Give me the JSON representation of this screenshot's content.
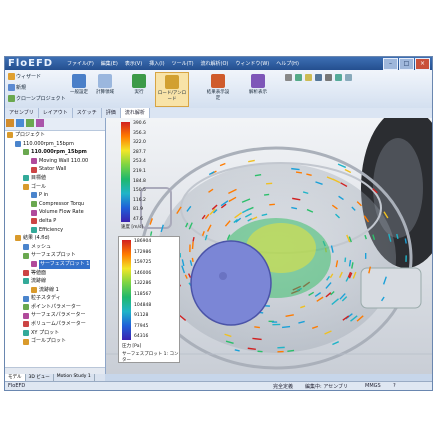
{
  "app": {
    "logo": "FloEFD"
  },
  "menus": [
    "ファイル(F)",
    "編集(E)",
    "表示(V)",
    "挿入(I)",
    "ツール(T)",
    "流れ解析(O)",
    "ウィンドウ(W)",
    "ヘルプ(H)"
  ],
  "toolbar": {
    "wizard": "ウィザード",
    "new": "新規",
    "clone": "クローンプロジェクト",
    "general_settings": "一般設定",
    "calc_domain": "計算領域",
    "solve": "実行",
    "load_results": "ロード/アンロード",
    "result_options": "結果表示設定",
    "result_options2": "解析表示"
  },
  "command_tabs": [
    "アセンブリ",
    "レイアウト",
    "スケッチ",
    "評価",
    "流れ解析"
  ],
  "tree": [
    {
      "label": "プロジェクト",
      "level": 0,
      "bold": false
    },
    {
      "label": "110.000rpm_15bpm",
      "level": 1,
      "bold": false
    },
    {
      "label": "110.000rpm_15bpm",
      "level": 2,
      "bold": true
    },
    {
      "label": "Moving Wall 110.00",
      "level": 3,
      "bold": false
    },
    {
      "label": "Stator Wall",
      "level": 3,
      "bold": false
    },
    {
      "label": "目標値",
      "level": 2,
      "bold": false
    },
    {
      "label": "ゴール",
      "level": 2,
      "bold": false
    },
    {
      "label": "P in",
      "level": 3,
      "bold": false
    },
    {
      "label": "Compressor Torqu",
      "level": 3,
      "bold": false
    },
    {
      "label": "Volume Flow Rate",
      "level": 3,
      "bold": false
    },
    {
      "label": "delta P",
      "level": 3,
      "bold": false
    },
    {
      "label": "Efficiency",
      "level": 3,
      "bold": false
    },
    {
      "label": "結果 (4.fld)",
      "level": 1,
      "bold": false
    },
    {
      "label": "メッシュ",
      "level": 2,
      "bold": false
    },
    {
      "label": "サーフェスプロット",
      "level": 2,
      "bold": false
    },
    {
      "label": "サーフェスプロット 1",
      "level": 3,
      "bold": false,
      "selected": true
    },
    {
      "label": "等値面",
      "level": 2,
      "bold": false
    },
    {
      "label": "流跡線",
      "level": 2,
      "bold": false
    },
    {
      "label": "流跡線 1",
      "level": 3,
      "bold": false
    },
    {
      "label": "粒子スタディ",
      "level": 2,
      "bold": false
    },
    {
      "label": "ポイントパラメーター",
      "level": 2,
      "bold": false
    },
    {
      "label": "サーフェスパラメーター",
      "level": 2,
      "bold": false
    },
    {
      "label": "ボリュームパラメーター",
      "level": 2,
      "bold": false
    },
    {
      "label": "XY プロット",
      "level": 2,
      "bold": false
    },
    {
      "label": "ゴールプロット",
      "level": 2,
      "bold": false
    }
  ],
  "legend_top": {
    "values": [
      "390.6",
      "356.3",
      "322.0",
      "287.7",
      "253.4",
      "219.1",
      "184.8",
      "150.5",
      "116.2",
      "81.9",
      "47.6"
    ],
    "caption": "速度 [m/s]"
  },
  "legend_bottom": {
    "values": [
      "186904",
      "172986",
      "159725",
      "146006",
      "132286",
      "118567",
      "104848",
      "91128",
      "77945",
      "64316"
    ],
    "caption": "圧力 [Pa]",
    "plot_name": "サーフェスプロット 1: コンター"
  },
  "bottom_tabs": [
    "モデル",
    "3D ビュー",
    "Motion Study 1"
  ],
  "status": {
    "left": "FloEFD",
    "mid": "完全定義",
    "mid2": "編集中: アセンブリ",
    "units": "MMGS",
    "help": "?"
  },
  "colors": {
    "titlebar": "#2f5fa3",
    "accent": "#3370c9",
    "impeller_disk": "#7b86d6"
  }
}
